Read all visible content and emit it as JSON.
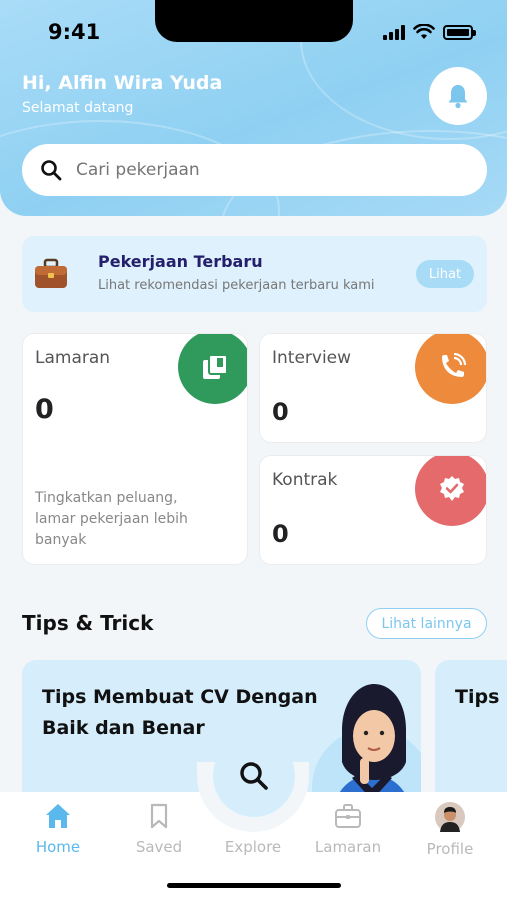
{
  "status_bar": {
    "time": "9:41"
  },
  "header": {
    "greeting": "Hi, Alfin Wira Yuda",
    "subtitle": "Selamat datang",
    "search_placeholder": "Cari pekerjaan"
  },
  "banner": {
    "title": "Pekerjaan Terbaru",
    "subtitle": "Lihat rekomendasi pekerjaan terbaru kami",
    "button": "Lihat"
  },
  "stats": {
    "lamaran": {
      "label": "Lamaran",
      "value": "0",
      "description": "Tingkatkan peluang, lamar pekerjaan lebih banyak",
      "color": "#2f9a5c"
    },
    "interview": {
      "label": "Interview",
      "value": "0",
      "color": "#ee8a3b"
    },
    "kontrak": {
      "label": "Kontrak",
      "value": "0",
      "color": "#e46a6c"
    }
  },
  "tips": {
    "title": "Tips & Trick",
    "more": "Lihat lainnya",
    "cards": [
      {
        "title": "Tips Membuat CV Dengan Baik dan Benar"
      },
      {
        "title": "Tips I"
      }
    ]
  },
  "nav": {
    "items": [
      {
        "label": "Home",
        "icon": "home-icon",
        "active": true
      },
      {
        "label": "Saved",
        "icon": "bookmark-icon"
      },
      {
        "label": "Explore",
        "icon": "search-icon"
      },
      {
        "label": "Lamaran",
        "icon": "briefcase-icon"
      },
      {
        "label": "Profile",
        "icon": "avatar"
      }
    ]
  },
  "colors": {
    "accent": "#8fd0f2",
    "active_nav": "#5bb8ec",
    "banner_title": "#231f6b"
  }
}
